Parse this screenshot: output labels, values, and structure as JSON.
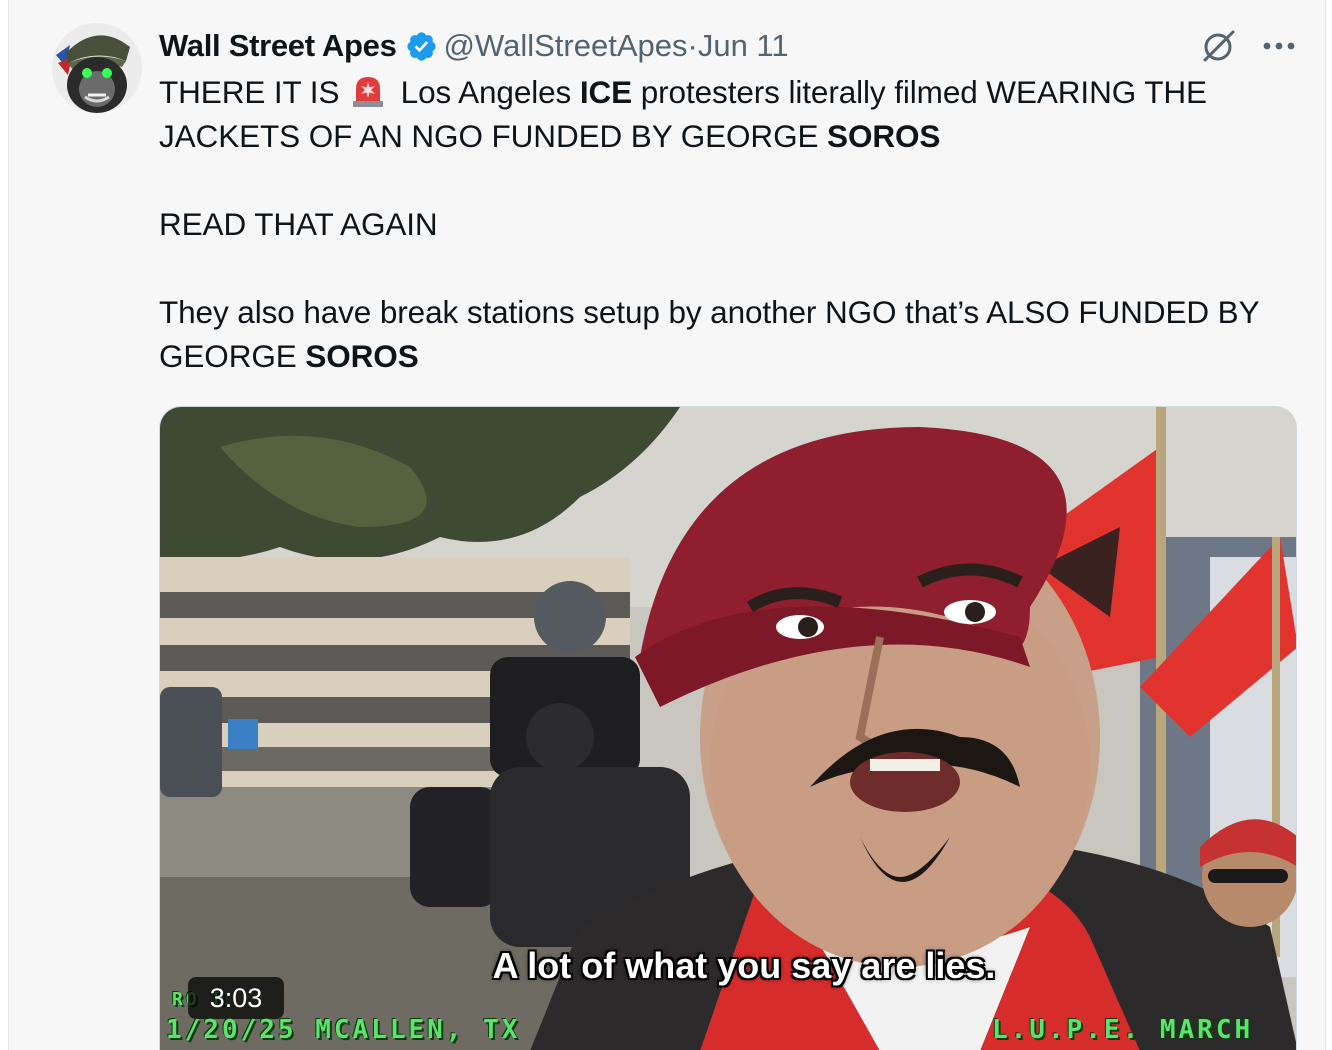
{
  "author": {
    "name": "Wall Street Apes",
    "handle": "@WallStreetApes",
    "date": "Jun 11",
    "separator": "·",
    "verified": true
  },
  "tweet": {
    "line1_a": "THERE IT IS",
    "line1_b": "Los Angeles",
    "line1_bold_ice": "ICE",
    "line1_c": "protesters literally filmed WEARING THE JACKETS OF AN NGO FUNDED BY GEORGE",
    "bold_soros_1": "SOROS",
    "line2": "READ THAT AGAIN",
    "line3_a": "They also have break stations setup by another NGO that’s ALSO FUNDED BY GEORGE",
    "bold_soros_2": "SOROS"
  },
  "media": {
    "subtitle": "A lot of what you say are lies.",
    "duration": "3:03",
    "overlay_left": "1/20/25 MCALLEN, TX",
    "overlay_right": "L.U.P.E. MARCH",
    "overlay_tiny": "RO    H"
  },
  "icons": {
    "verified": "verified-badge-icon",
    "grok": "grok-icon",
    "more": "more-options-icon",
    "siren": "police-siren-emoji"
  },
  "colors": {
    "verified_blue": "#1d9bf0",
    "text": "#0f1419",
    "muted": "#536471",
    "card_bg": "#f7f7f7"
  }
}
